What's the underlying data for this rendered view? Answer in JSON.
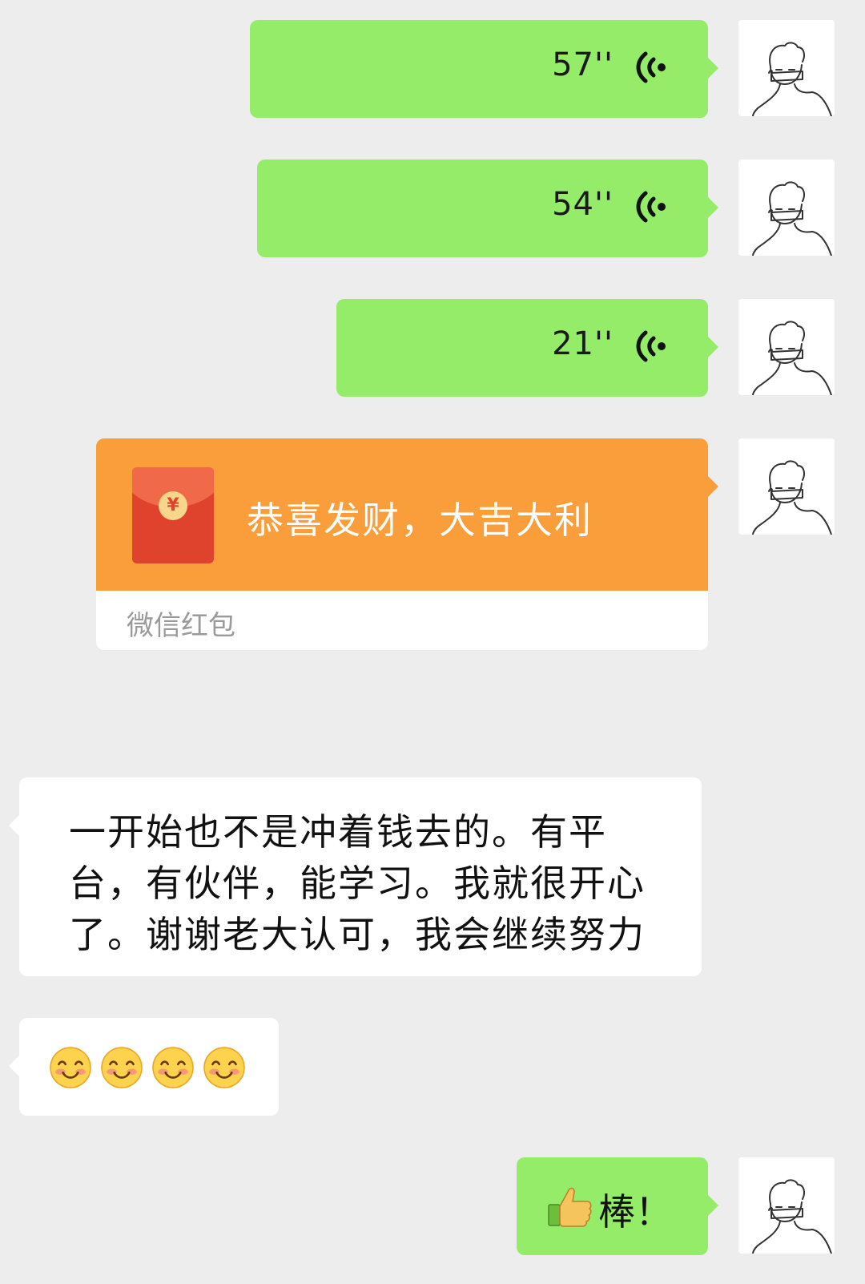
{
  "messages": {
    "voice_1": {
      "duration": "57''"
    },
    "voice_2": {
      "duration": "54''"
    },
    "voice_3": {
      "duration": "21''"
    },
    "red_packet": {
      "icon_symbol": "¥",
      "greeting": "恭喜发财，大吉大利",
      "brand": "微信红包"
    },
    "text_reply": {
      "text": "一开始也不是冲着钱去的。有平台，有伙伴，能学习。我就很开心了。谢谢老大认可，我会继续努力"
    },
    "emoji_reply": {
      "icons": [
        "smiling-face-icon",
        "smiling-face-icon",
        "smiling-face-icon",
        "smiling-face-icon"
      ]
    },
    "praise": {
      "icon": "thumbs-up-icon",
      "text": "棒！"
    }
  },
  "avatar": {
    "icon": "masked-person-avatar-icon"
  },
  "colors": {
    "background": "#ededed",
    "sent_bubble": "#95ec69",
    "received_bubble": "#ffffff",
    "red_packet": "#fa9d3b"
  }
}
